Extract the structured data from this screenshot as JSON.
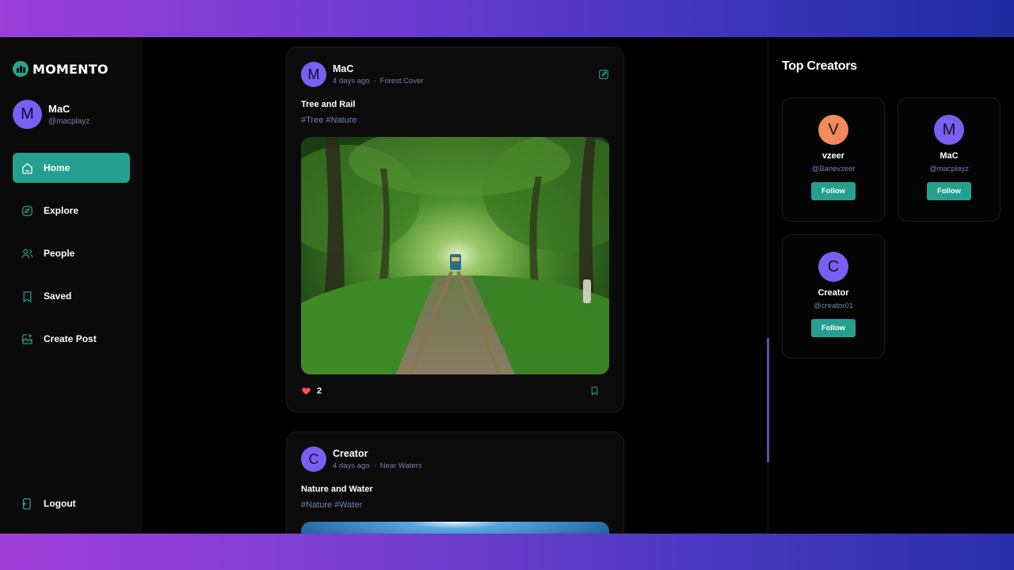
{
  "brand": {
    "name": "MOMENTO",
    "accent": "#26a08e",
    "avatar_color": "#7a5ff5"
  },
  "user": {
    "initial": "M",
    "name": "MaC",
    "handle": "@macplayz"
  },
  "nav": {
    "items": [
      {
        "label": "Home",
        "icon": "home-icon",
        "active": true
      },
      {
        "label": "Explore",
        "icon": "explore-icon",
        "active": false
      },
      {
        "label": "People",
        "icon": "people-icon",
        "active": false
      },
      {
        "label": "Saved",
        "icon": "bookmark-icon",
        "active": false
      },
      {
        "label": "Create Post",
        "icon": "create-post-icon",
        "active": false
      }
    ],
    "logout_label": "Logout"
  },
  "feed": {
    "posts": [
      {
        "author_initial": "M",
        "author": "MaC",
        "time": "4 days ago",
        "separator": "-",
        "location": "Forest Cover",
        "caption": "Tree and Rail",
        "tags": "#Tree #Nature",
        "likes": "2",
        "image": "forest railway tunnel of trees with train"
      },
      {
        "author_initial": "C",
        "author": "Creator",
        "time": "4 days ago",
        "separator": "-",
        "location": "Near Waters",
        "caption": "Nature and Water",
        "tags": "#Nature #Water",
        "image": "blue water sky"
      }
    ]
  },
  "top_creators": {
    "title": "Top Creators",
    "creators": [
      {
        "initial": "V",
        "name": "vzeer",
        "handle": "@Banevzeer",
        "follow_label": "Follow",
        "color": "#f28a5c"
      },
      {
        "initial": "M",
        "name": "MaC",
        "handle": "@macplayz",
        "follow_label": "Follow",
        "color": "#7a5ff5"
      },
      {
        "initial": "C",
        "name": "Creator",
        "handle": "@creator01",
        "follow_label": "Follow",
        "color": "#7a5ff5"
      }
    ]
  }
}
